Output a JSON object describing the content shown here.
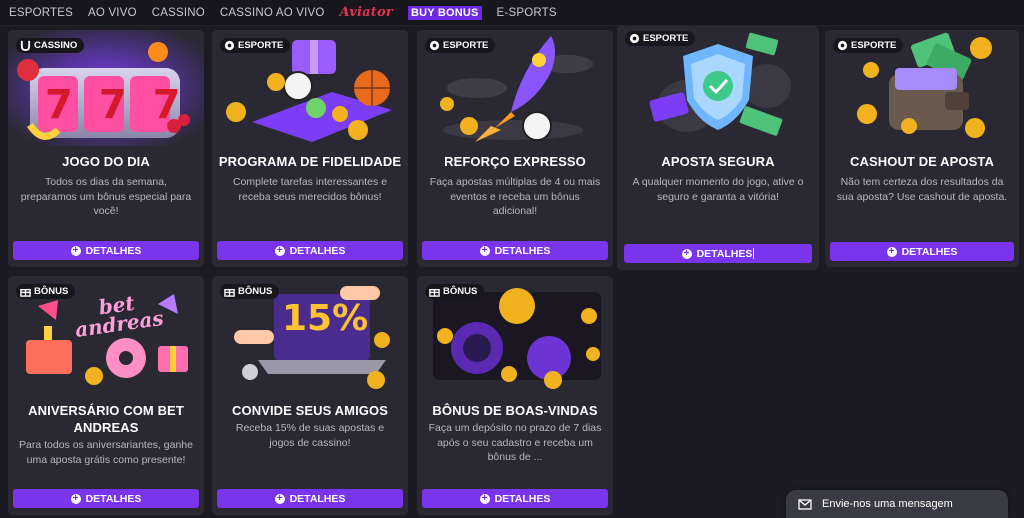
{
  "nav": {
    "items": [
      "ESPORTES",
      "AO VIVO",
      "CASSINO",
      "CASSINO AO VIVO"
    ],
    "aviator": "Aviator",
    "buy_bonus": "BUY BONUS",
    "esports": "E-SPORTS"
  },
  "cards": [
    {
      "badge": "CASSINO",
      "badge_icon": "horseshoe-icon",
      "title": "JOGO DO DIA",
      "desc": "Todos os dias da semana, preparamos um bônus especial para você!",
      "button": "DETALHES"
    },
    {
      "badge": "ESPORTE",
      "badge_icon": "ball-icon",
      "title": "PROGRAMA DE FIDELIDADE",
      "desc": "Complete tarefas interessantes e receba seus merecidos bônus!",
      "button": "DETALHES"
    },
    {
      "badge": "ESPORTE",
      "badge_icon": "ball-icon",
      "title": "REFORÇO EXPRESSO",
      "desc": "Faça apostas múltiplas de 4 ou mais eventos e receba um bônus adicional!",
      "button": "DETALHES"
    },
    {
      "badge": "ESPORTE",
      "badge_icon": "ball-icon",
      "title": "APOSTA SEGURA",
      "desc": "A qualquer momento do jogo, ative o seguro e garanta a vitória!",
      "button": "DETALHES"
    },
    {
      "badge": "ESPORTE",
      "badge_icon": "ball-icon",
      "title": "CASHOUT DE APOSTA",
      "desc": "Não tem certeza dos resultados da sua aposta? Use cashout de aposta.",
      "button": "DETALHES"
    },
    {
      "badge": "BÔNUS",
      "badge_icon": "gift-icon",
      "title": "ANIVERSÁRIO COM BET ANDREAS",
      "desc": "Para todos os aniversariantes, ganhe uma aposta grátis como presente!",
      "button": "DETALHES"
    },
    {
      "badge": "BÔNUS",
      "badge_icon": "gift-icon",
      "title": "CONVIDE SEUS AMIGOS",
      "desc": "Receba 15% de suas apostas e jogos de cassino!",
      "button": "DETALHES"
    },
    {
      "badge": "BÔNUS",
      "badge_icon": "gift-icon",
      "title": "BÔNUS DE BOAS-VINDAS",
      "desc": "Faça um depósito no prazo de 7 dias após o seu cadastro e receba um bônus de ...",
      "button": "DETALHES"
    }
  ],
  "art_text": {
    "slot": "777",
    "bet_logo": "bet andreas",
    "percent": "15%"
  },
  "chat": {
    "label": "Envie-nos uma mensagem"
  },
  "colors": {
    "accent": "#7a34ec",
    "aviator": "#e0334f",
    "bg": "#1c1b24",
    "card": "#2a2933"
  }
}
